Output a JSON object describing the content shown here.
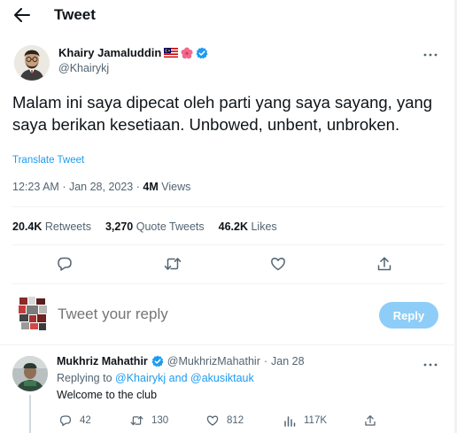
{
  "header": {
    "title": "Tweet"
  },
  "tweet": {
    "author_name": "Khairy Jamaluddin",
    "author_handle": "@Khairykj",
    "flags": [
      "malaysia-flag-emoji",
      "hibiscus-emoji",
      "verified-badge"
    ],
    "text": "Malam ini saya dipecat oleh parti yang saya sayang, yang saya berikan kesetiaan. Unbowed, unbent, unbroken.",
    "translate_label": "Translate Tweet",
    "time": "12:23 AM",
    "date": "Jan 28, 2023",
    "separator": "·",
    "views_count": "4M",
    "views_label": "Views",
    "retweets_count": "20.4K",
    "retweets_label": "Retweets",
    "quotes_count": "3,270",
    "quotes_label": "Quote Tweets",
    "likes_count": "46.2K",
    "likes_label": "Likes",
    "action_icons": [
      "reply-icon",
      "retweet-icon",
      "like-icon",
      "share-icon"
    ]
  },
  "composer": {
    "placeholder": "Tweet your reply",
    "reply_button_label": "Reply"
  },
  "reply": {
    "author_name": "Mukhriz Mahathir",
    "author_handle": "@MukhrizMahathir",
    "separator": "·",
    "time": "Jan 28",
    "replying_prefix": "Replying to",
    "replying_to_1": "@Khairykj",
    "replying_and": "and",
    "replying_to_2": "@akusiktauk",
    "text": "Welcome to the club",
    "reply_count": "42",
    "retweet_count": "130",
    "like_count": "812",
    "views_count": "117K"
  },
  "colors": {
    "accent": "#1d9bf0",
    "reply_button_disabled": "#8ecdf8",
    "text_primary": "#0f1419",
    "text_secondary": "#536471",
    "divider": "#eff3f4"
  }
}
